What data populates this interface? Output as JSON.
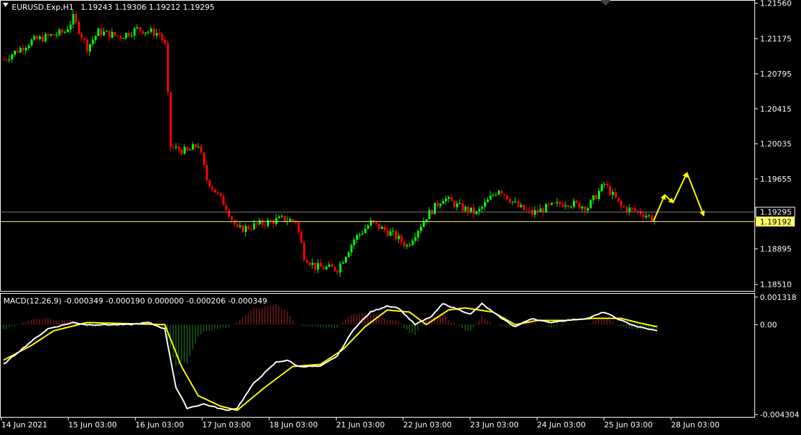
{
  "header": {
    "symbol": "EURUSD.Exp,H1",
    "ohlc": "1.19243 1.19306 1.19212 1.19295"
  },
  "macd": {
    "label": "MACD(12,26,9) -0.000349 -0.000190 0.000000 -0.000206 -0.000349"
  },
  "colors": {
    "background": "#000000",
    "bull": "#00ff00",
    "bear": "#ff0000",
    "grid": "#ffffff",
    "bid_line": "#808080",
    "ask_line": "#ffff66",
    "macd_main": "#ffffff",
    "macd_signal": "#ffff00",
    "hist_pos": "#b22222",
    "hist_neg": "#228b22",
    "arrow": "#ffff00"
  },
  "chart_data": [
    {
      "type": "candlestick",
      "timeframe": "H1",
      "price_labels": [
        "1.21560",
        "1.21175",
        "1.20795",
        "1.20415",
        "1.20035",
        "1.19655",
        "1.19295",
        "1.18895",
        "1.18510"
      ],
      "price_ticks": [
        1.2156,
        1.21175,
        1.20795,
        1.20415,
        1.20035,
        1.19655,
        1.19275,
        1.18895,
        1.1851
      ],
      "ylim": [
        1.1844,
        1.2158
      ],
      "bid": 1.19295,
      "bid_label": "1.19295",
      "ask": 1.19192,
      "ask_label": "1.19192",
      "x_labels": [
        "14 Jun 2021",
        "15 Jun 03:00",
        "16 Jun 03:00",
        "17 Jun 03:00",
        "18 Jun 03:00",
        "21 Jun 03:00",
        "22 Jun 03:00",
        "23 Jun 03:00",
        "24 Jun 03:00",
        "25 Jun 03:00",
        "28 Jun 03:00"
      ],
      "path_keypoints": [
        [
          0,
          1.2095
        ],
        [
          10,
          1.2115
        ],
        [
          22,
          1.2125
        ],
        [
          25,
          1.214
        ],
        [
          30,
          1.2108
        ],
        [
          34,
          1.2125
        ],
        [
          42,
          1.212
        ],
        [
          48,
          1.2128
        ],
        [
          56,
          1.2123
        ],
        [
          58,
          1.211
        ],
        [
          60,
          1.2
        ],
        [
          66,
          1.1995
        ],
        [
          70,
          1.2003
        ],
        [
          73,
          1.1965
        ],
        [
          80,
          1.1935
        ],
        [
          84,
          1.191
        ],
        [
          94,
          1.1918
        ],
        [
          100,
          1.1922
        ],
        [
          105,
          1.192
        ],
        [
          108,
          1.1882
        ],
        [
          112,
          1.187
        ],
        [
          120,
          1.1868
        ],
        [
          126,
          1.19
        ],
        [
          132,
          1.1918
        ],
        [
          140,
          1.1905
        ],
        [
          145,
          1.1893
        ],
        [
          152,
          1.1925
        ],
        [
          158,
          1.1945
        ],
        [
          164,
          1.1935
        ],
        [
          170,
          1.1928
        ],
        [
          178,
          1.1955
        ],
        [
          185,
          1.1935
        ],
        [
          190,
          1.1928
        ],
        [
          196,
          1.1935
        ],
        [
          202,
          1.194
        ],
        [
          210,
          1.1935
        ],
        [
          216,
          1.196
        ],
        [
          222,
          1.1935
        ],
        [
          228,
          1.193
        ],
        [
          232,
          1.1925
        ],
        [
          234,
          1.192
        ]
      ],
      "projection_arrows": [
        [
          [
            234,
            1.192
          ],
          [
            238,
            1.1948
          ],
          [
            241,
            1.194
          ],
          [
            246,
            1.1972
          ],
          [
            252,
            1.1926
          ]
        ]
      ]
    },
    {
      "type": "macd",
      "params": [
        12,
        26,
        9
      ],
      "y_labels": [
        "0.001318",
        "0.00",
        "-0.004304"
      ],
      "y_ticks": [
        0.001318,
        0.0,
        -0.004304
      ],
      "ylim": [
        -0.00445,
        0.00148
      ],
      "macd_keypoints": [
        [
          0,
          -0.0019
        ],
        [
          10,
          -0.0008
        ],
        [
          16,
          -0.0002
        ],
        [
          25,
          0.0001
        ],
        [
          30,
          0.0
        ],
        [
          45,
          0.0
        ],
        [
          52,
          0.0001
        ],
        [
          58,
          -0.0002
        ],
        [
          62,
          -0.003
        ],
        [
          66,
          -0.004
        ],
        [
          72,
          -0.0038
        ],
        [
          80,
          -0.0041
        ],
        [
          84,
          -0.004
        ],
        [
          90,
          -0.0028
        ],
        [
          98,
          -0.0018
        ],
        [
          102,
          -0.0017
        ],
        [
          106,
          -0.002
        ],
        [
          114,
          -0.002
        ],
        [
          120,
          -0.0015
        ],
        [
          126,
          -0.0002
        ],
        [
          132,
          0.0006
        ],
        [
          138,
          0.0009
        ],
        [
          142,
          0.0008
        ],
        [
          148,
          0.0
        ],
        [
          154,
          0.0004
        ],
        [
          158,
          0.001
        ],
        [
          164,
          0.0007
        ],
        [
          168,
          0.0005
        ],
        [
          172,
          0.001
        ],
        [
          178,
          0.0004
        ],
        [
          184,
          -0.0001
        ],
        [
          190,
          0.0003
        ],
        [
          196,
          0.0001
        ],
        [
          202,
          0.0002
        ],
        [
          210,
          0.0003
        ],
        [
          216,
          0.0006
        ],
        [
          222,
          0.0002
        ],
        [
          228,
          -0.0001
        ],
        [
          235,
          -0.0003
        ]
      ],
      "signal_keypoints": [
        [
          0,
          -0.0017
        ],
        [
          10,
          -0.001
        ],
        [
          18,
          -0.0003
        ],
        [
          30,
          0.0001
        ],
        [
          58,
          0.0
        ],
        [
          64,
          -0.002
        ],
        [
          70,
          -0.0034
        ],
        [
          78,
          -0.0039
        ],
        [
          84,
          -0.0041
        ],
        [
          94,
          -0.003
        ],
        [
          104,
          -0.002
        ],
        [
          114,
          -0.0019
        ],
        [
          122,
          -0.0012
        ],
        [
          130,
          -0.0001
        ],
        [
          138,
          0.0007
        ],
        [
          146,
          0.0006
        ],
        [
          152,
          0.0
        ],
        [
          160,
          0.0007
        ],
        [
          166,
          0.0008
        ],
        [
          176,
          0.0006
        ],
        [
          184,
          0.0
        ],
        [
          192,
          0.0002
        ],
        [
          202,
          0.0002
        ],
        [
          212,
          0.0003
        ],
        [
          222,
          0.0003
        ],
        [
          228,
          0.0001
        ],
        [
          235,
          -0.0001
        ]
      ]
    }
  ]
}
